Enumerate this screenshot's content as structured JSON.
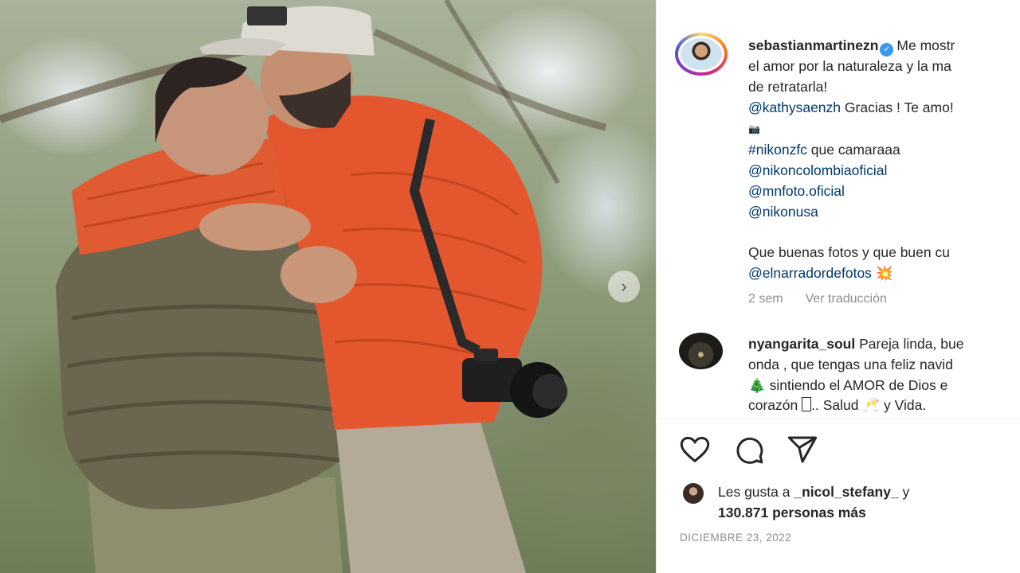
{
  "post": {
    "username": "sebastianmartinezn",
    "caption_lines": [
      "Me mostr",
      "el amor por la naturaleza y la ma",
      "de retratarla!"
    ],
    "mention_1": "@kathysaenzh",
    "mention_1_text": " Gracias ! Te amo!",
    "camera_emoji": "📷",
    "hashtag": "#nikonzfc",
    "hashtag_text": " que camaraaa",
    "mention_2": "@nikoncolombiaoficial",
    "mention_3": "@mnfoto.oficial",
    "mention_4": "@nikonusa",
    "line_after": "Que buenas fotos y que buen cu",
    "mention_5": "@elnarradordefotos",
    "burst_emoji": "💥",
    "time_ago": "2 sem",
    "translate_label": "Ver traducción"
  },
  "comment": {
    "username": "nyangarita_soul",
    "text_line_1": " Pareja linda, bue",
    "text_line_2": "onda , que tengas una feliz navid",
    "tree_emoji": "🎄",
    "text_line_3": " sintiendo el AMOR de Dios e",
    "text_line_4a": "corazón ",
    "text_line_4b": ".. Salud ",
    "glasses_emoji": "🥂",
    "text_line_4c": " y Vida."
  },
  "likes": {
    "prefix": "Les gusta a ",
    "user": "_nicol_stefany_",
    "suffix": " y",
    "count": "130.871 personas más"
  },
  "date": "DICIEMBRE 23, 2022",
  "icons": {
    "like": "heart-icon",
    "comment": "comment-icon",
    "share": "share-icon",
    "next": "chevron-right-icon"
  }
}
